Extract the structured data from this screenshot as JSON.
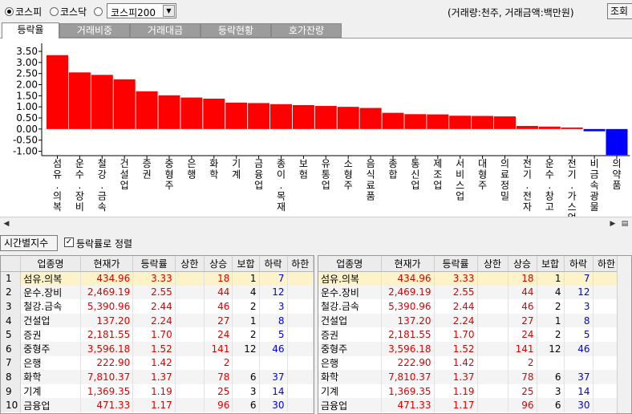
{
  "market_radios": [
    {
      "label": "코스피",
      "checked": true
    },
    {
      "label": "코스닥",
      "checked": false
    },
    {
      "label": "",
      "checked": false
    }
  ],
  "index_select": {
    "value": "코스피200"
  },
  "unit_text": "(거래량:천주, 거래금액:백만원)",
  "query_button": "조회",
  "tabs": [
    "등락율",
    "거래비중",
    "거래대금",
    "등락현황",
    "호가잔량"
  ],
  "active_tab": 0,
  "time_index_button": "시간별지수",
  "sort_checkbox": {
    "label": "등락률로 정렬",
    "checked": true
  },
  "chart_data": {
    "type": "bar",
    "categories": [
      "섬유.의복",
      "운수.장비",
      "철강.금속",
      "건설업",
      "증권",
      "중형주",
      "은행",
      "화학",
      "기계",
      "금융업",
      "종이.목재",
      "보험",
      "유통업",
      "소형주",
      "음식료품",
      "종합",
      "통신업",
      "제조업",
      "서비스업",
      "대형주",
      "의료정밀",
      "전기.전자",
      "운수.창고",
      "전기.가스업",
      "비금속광물",
      "의약품"
    ],
    "values": [
      3.33,
      2.55,
      2.44,
      2.24,
      1.7,
      1.52,
      1.42,
      1.37,
      1.19,
      1.17,
      1.12,
      1.08,
      1.04,
      1.0,
      0.95,
      0.73,
      0.67,
      0.66,
      0.6,
      0.59,
      0.57,
      0.14,
      0.11,
      0.07,
      -0.1,
      -1.17
    ],
    "yticks": [
      "3.50",
      "3.00",
      "2.50",
      "2.00",
      "1.50",
      "1.00",
      "0.50",
      "0.00",
      "-0.50",
      "-1.00"
    ],
    "ylim": [
      -1.2,
      3.5
    ],
    "colors": {
      "positive": "#ff0000",
      "negative": "#0000ff"
    },
    "grid": false
  },
  "table_headers": [
    "업종명",
    "현재가",
    "등락률",
    "상한",
    "상승",
    "보합",
    "하락",
    "하한"
  ],
  "table_rows": [
    {
      "no": "1",
      "name": "섬유.의복",
      "price": "434.96",
      "rate": "3.33",
      "upper": "",
      "up": "18",
      "flat": "1",
      "down": "7",
      "lower": ""
    },
    {
      "no": "2",
      "name": "운수.장비",
      "price": "2,469.19",
      "rate": "2.55",
      "upper": "",
      "up": "44",
      "flat": "4",
      "down": "12",
      "lower": ""
    },
    {
      "no": "3",
      "name": "철강.금속",
      "price": "5,390.96",
      "rate": "2.44",
      "upper": "",
      "up": "46",
      "flat": "2",
      "down": "3",
      "lower": ""
    },
    {
      "no": "4",
      "name": "건설업",
      "price": "137.20",
      "rate": "2.24",
      "upper": "",
      "up": "27",
      "flat": "1",
      "down": "8",
      "lower": ""
    },
    {
      "no": "5",
      "name": "증권",
      "price": "2,181.55",
      "rate": "1.70",
      "upper": "",
      "up": "24",
      "flat": "2",
      "down": "5",
      "lower": ""
    },
    {
      "no": "6",
      "name": "중형주",
      "price": "3,596.18",
      "rate": "1.52",
      "upper": "",
      "up": "141",
      "flat": "12",
      "down": "46",
      "lower": ""
    },
    {
      "no": "7",
      "name": "은행",
      "price": "222.90",
      "rate": "1.42",
      "upper": "",
      "up": "2",
      "flat": "",
      "down": "",
      "lower": ""
    },
    {
      "no": "8",
      "name": "화학",
      "price": "7,810.37",
      "rate": "1.37",
      "upper": "",
      "up": "78",
      "flat": "6",
      "down": "37",
      "lower": ""
    },
    {
      "no": "9",
      "name": "기계",
      "price": "1,369.35",
      "rate": "1.19",
      "upper": "",
      "up": "25",
      "flat": "3",
      "down": "14",
      "lower": ""
    },
    {
      "no": "10",
      "name": "금융업",
      "price": "471.33",
      "rate": "1.17",
      "upper": "",
      "up": "96",
      "flat": "6",
      "down": "30",
      "lower": ""
    }
  ]
}
